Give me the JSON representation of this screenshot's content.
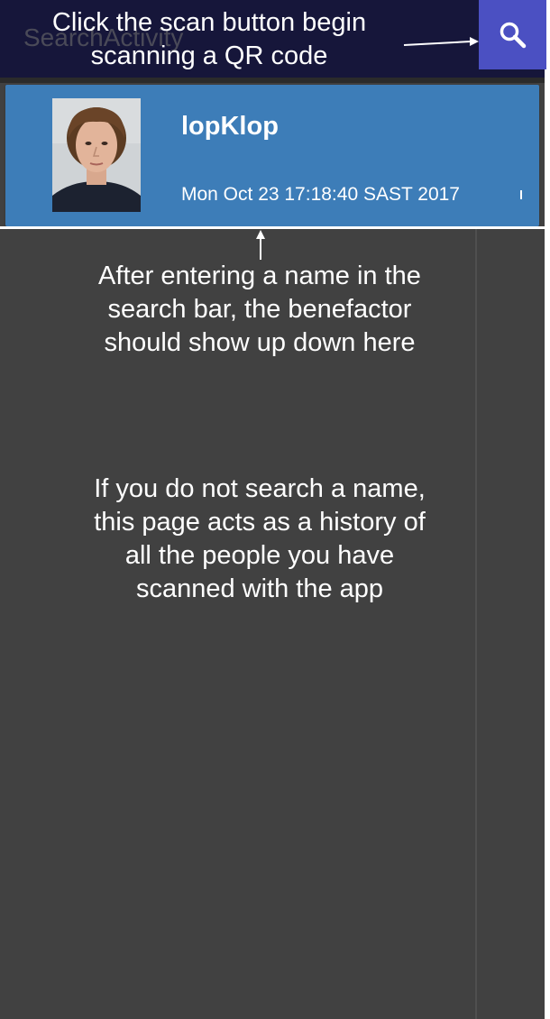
{
  "toolbar": {
    "title": "SearchActivity",
    "scan_button_icon": "search-icon",
    "background_color": "#16163a",
    "button_color": "#4b50c2"
  },
  "annotations": {
    "scan_hint": "Click the scan button begin scanning a QR code",
    "result_hint": "After entering a name in the\nsearch bar, the benefactor\nshould show up down here",
    "history_hint": "If you do not search a name,\nthis page acts as a history of\nall the people you have\nscanned with the app"
  },
  "results": [
    {
      "name": "lopKlop",
      "timestamp": "Mon Oct 23 17:18:40 SAST 2017",
      "avatar": "person-photo",
      "card_color": "#3d7db8"
    }
  ],
  "colors": {
    "page_background": "#414141"
  }
}
